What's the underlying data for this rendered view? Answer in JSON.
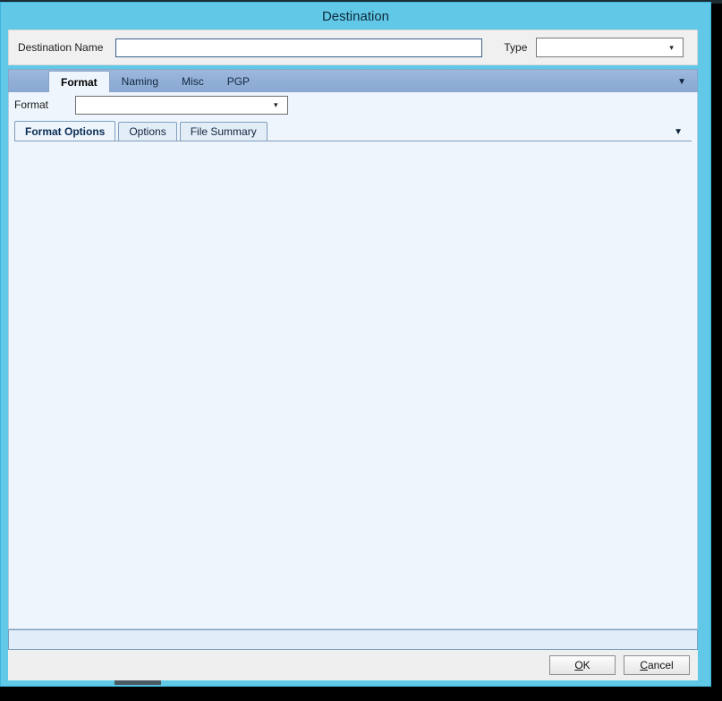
{
  "window": {
    "title": "Destination",
    "accent_color": "#62c8e8",
    "panel_color": "#eef5fc"
  },
  "header": {
    "destination_name": {
      "label": "Destination Name",
      "value": "",
      "placeholder": ""
    },
    "type": {
      "label": "Type",
      "value": "",
      "options": [
        ""
      ]
    }
  },
  "outer_tabs": {
    "items": [
      {
        "label": "Format",
        "active": true
      },
      {
        "label": "Naming",
        "active": false
      },
      {
        "label": "Misc",
        "active": false
      },
      {
        "label": "PGP",
        "active": false
      }
    ],
    "overflow_icon": "chevron-down-icon",
    "overflow_glyph": "▼"
  },
  "format_row": {
    "label": "Format",
    "value": "",
    "options": [
      ""
    ]
  },
  "inner_tabs": {
    "items": [
      {
        "label": "Format Options",
        "active": true
      },
      {
        "label": "Options",
        "active": false
      },
      {
        "label": "File Summary",
        "active": false
      }
    ],
    "overflow_icon": "chevron-down-icon",
    "overflow_glyph": "▼"
  },
  "footer": {
    "ok": {
      "accel": "O",
      "rest": "K"
    },
    "cancel": {
      "accel": "C",
      "rest": "ancel"
    }
  }
}
